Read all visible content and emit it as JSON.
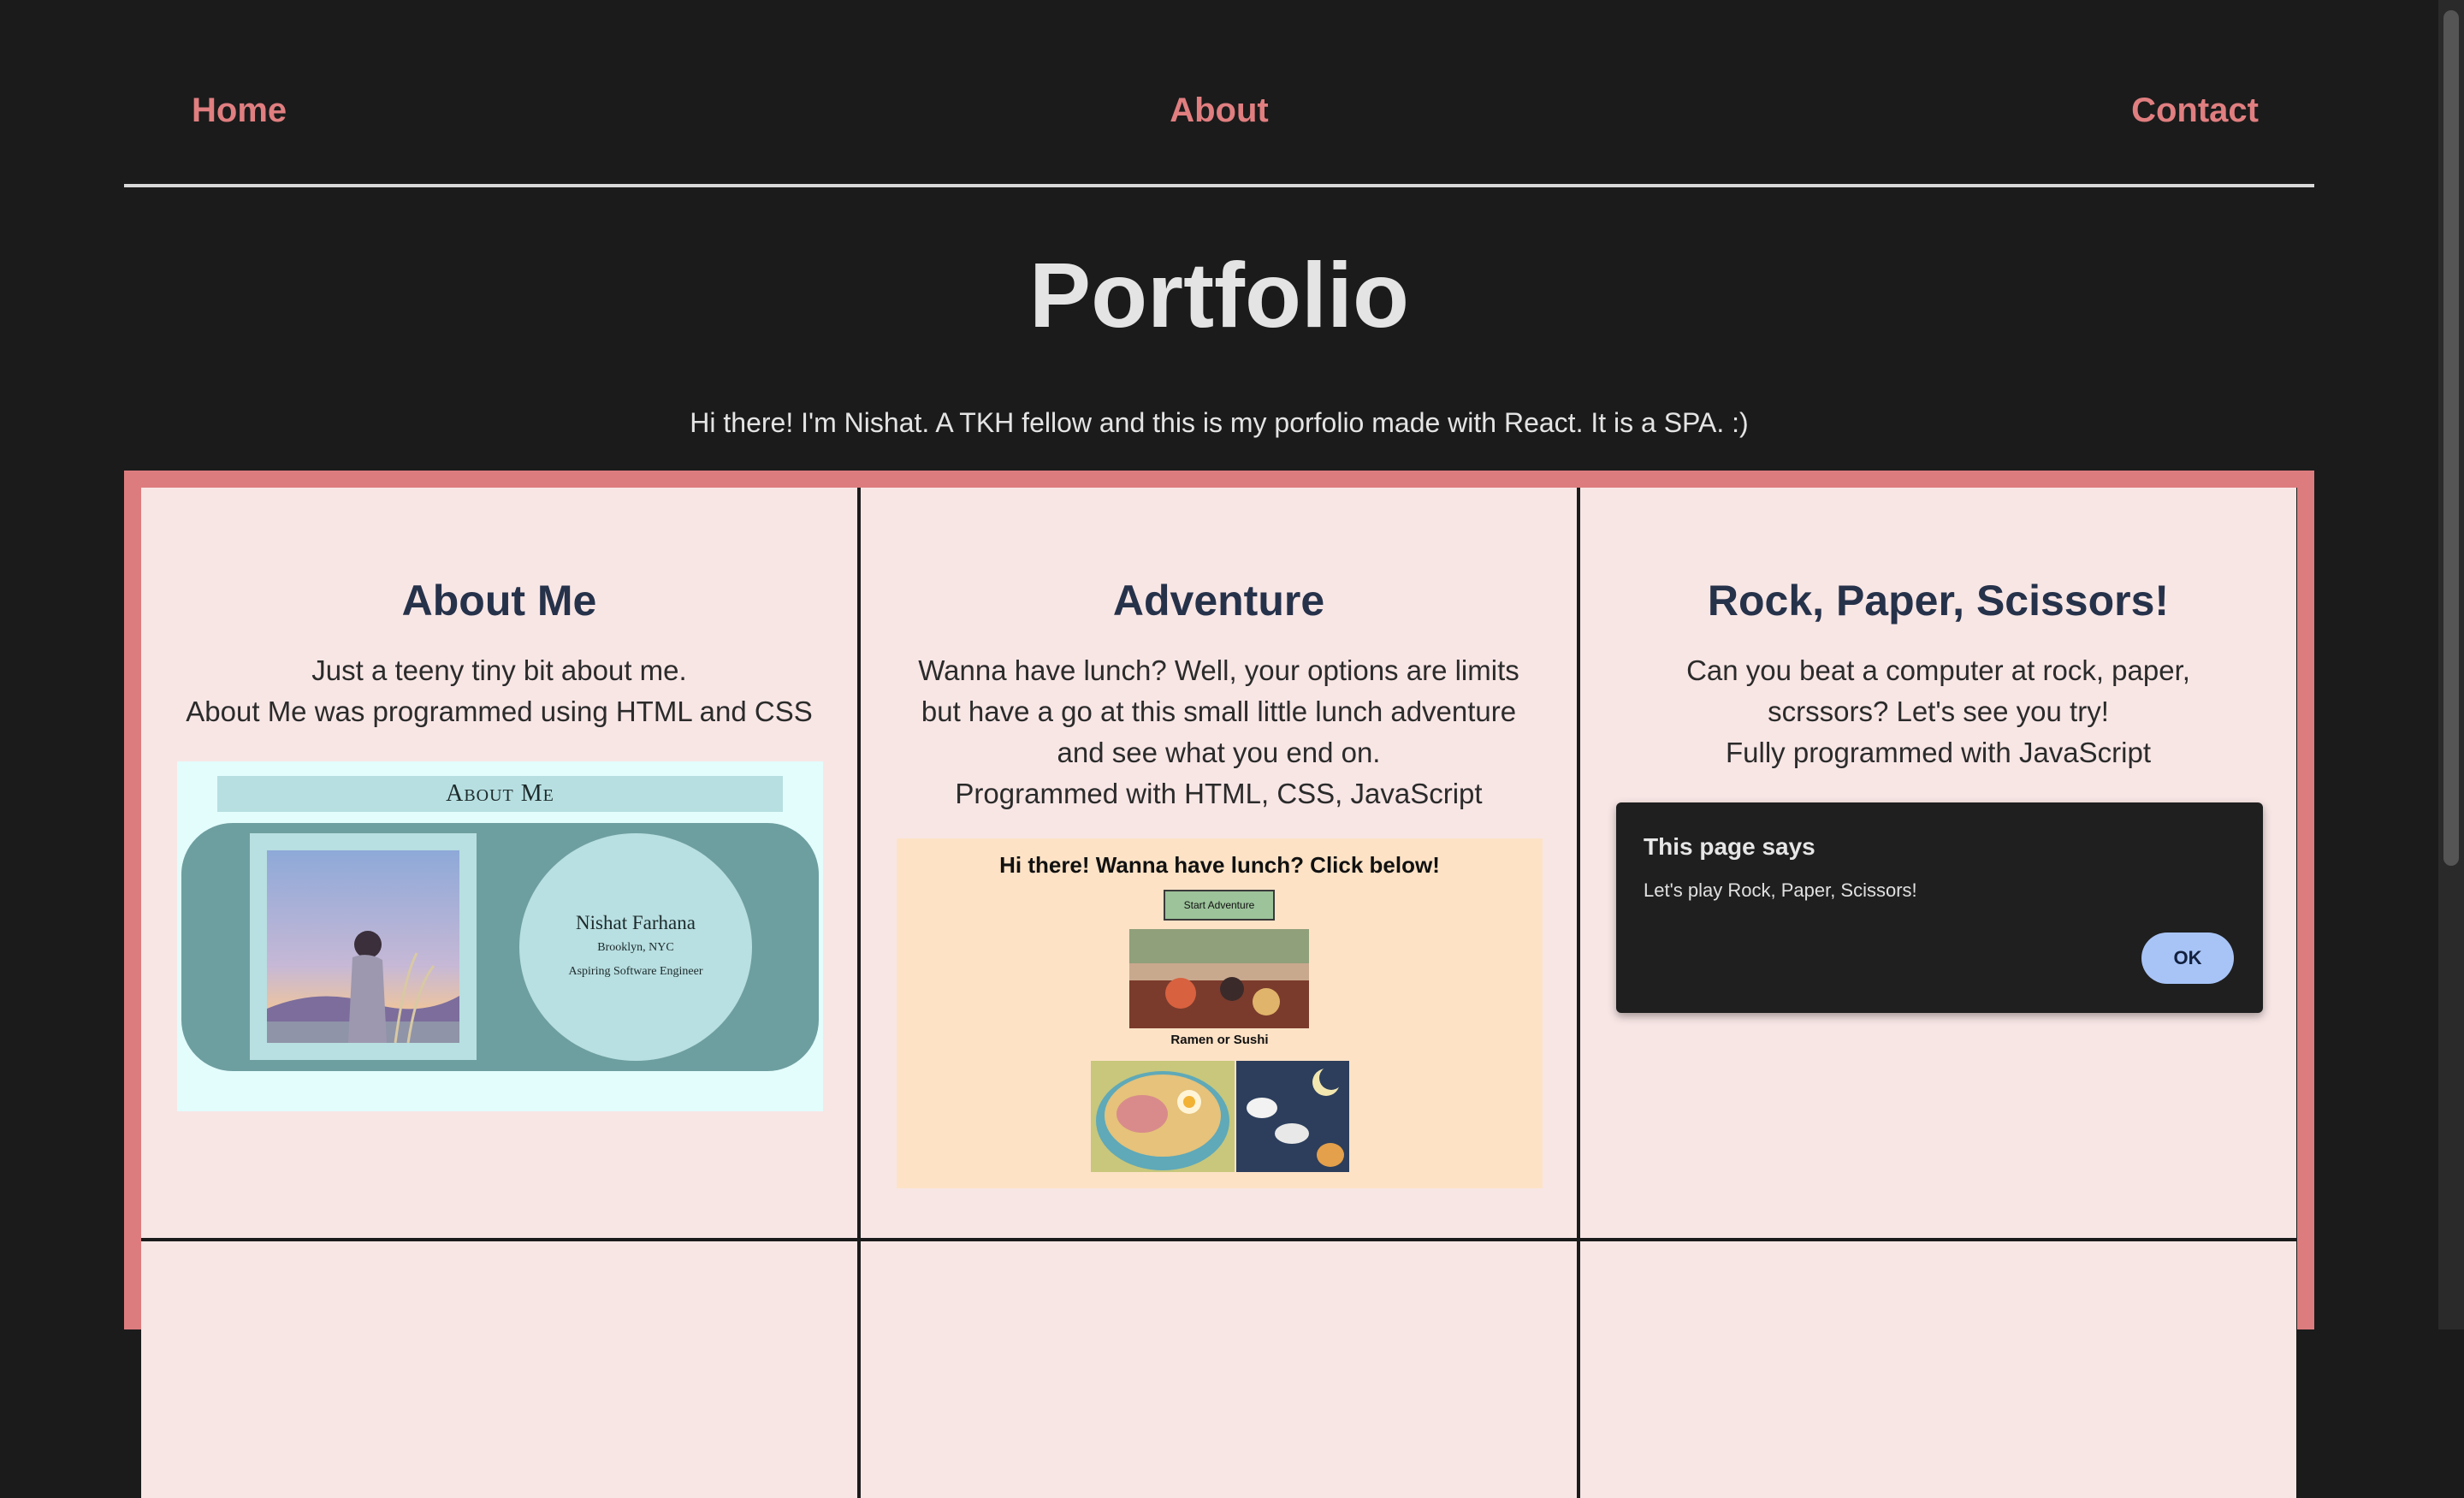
{
  "nav": {
    "home": "Home",
    "about": "About",
    "contact": "Contact"
  },
  "page": {
    "title": "Portfolio",
    "intro": "Hi there! I'm Nishat. A TKH fellow and this is my porfolio made with React. It is a SPA. :)"
  },
  "cards": [
    {
      "title": "About Me",
      "desc_lines": [
        "Just a teeny tiny bit about me.",
        "About Me was programmed using HTML and CSS"
      ],
      "preview": {
        "banner": "About Me",
        "name": "Nishat Farhana",
        "location": "Brooklyn, NYC",
        "role": "Aspiring Software Engineer"
      }
    },
    {
      "title": "Adventure",
      "desc_lines": [
        "Wanna have lunch? Well, your options are limits",
        "but have a go at this small little lunch adventure",
        "and see what you end on.",
        "Programmed with HTML, CSS, JavaScript"
      ],
      "preview": {
        "heading": "Hi there! Wanna have lunch? Click below!",
        "button": "Start Adventure",
        "caption": "Ramen or Sushi"
      }
    },
    {
      "title": "Rock, Paper, Scissors!",
      "desc_lines": [
        "Can you beat a computer at rock, paper,",
        "scrssors? Let's see you try!",
        "Fully programmed with JavaScript"
      ],
      "dialog": {
        "title": "This page says",
        "message": "Let's play Rock, Paper, Scissors!",
        "ok": "OK"
      }
    }
  ],
  "colors": {
    "background": "#1b1b1b",
    "accent": "#e07e80",
    "card": "#f8e6e5",
    "card_title": "#26324a",
    "frame": "#dd7c7e"
  }
}
